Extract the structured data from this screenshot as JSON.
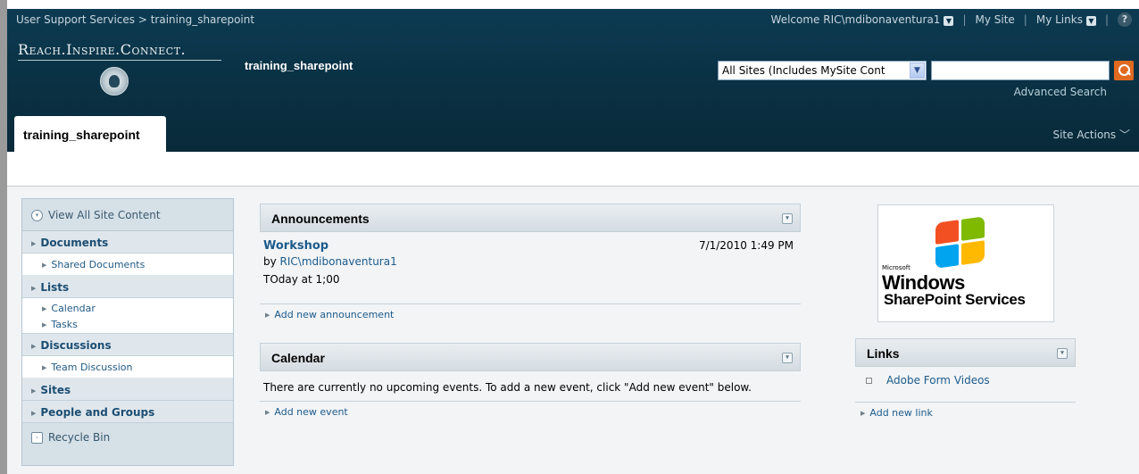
{
  "topbar": {
    "breadcrumb": "User Support Services > training_sharepoint",
    "welcome": "Welcome RIC\\mdibonaventura1",
    "my_site": "My Site",
    "my_links": "My Links",
    "help_glyph": "?"
  },
  "brand": {
    "logo_text": "Reach.Inspire.Connect.",
    "site_title": "training_sharepoint"
  },
  "search": {
    "scope_selected": "All Sites (Includes MySite Cont",
    "query_value": "",
    "advanced_label": "Advanced Search"
  },
  "tabs": [
    {
      "label": "training_sharepoint",
      "active": true
    }
  ],
  "site_actions_label": "Site Actions",
  "quick_launch": {
    "view_all": "View All Site Content",
    "sections": [
      {
        "label": "Documents",
        "items": [
          "Shared Documents"
        ]
      },
      {
        "label": "Lists",
        "items": [
          "Calendar",
          "Tasks"
        ]
      },
      {
        "label": "Discussions",
        "items": [
          "Team Discussion"
        ]
      },
      {
        "label": "Sites",
        "items": []
      },
      {
        "label": "People and Groups",
        "items": []
      }
    ],
    "recycle_bin": "Recycle Bin"
  },
  "announcements": {
    "title": "Announcements",
    "items": [
      {
        "title": "Workshop",
        "date": "7/1/2010 1:49 PM",
        "by_prefix": "by ",
        "author": "RIC\\mdibonaventura1",
        "body": "TOday at 1;00"
      }
    ],
    "add_label": "Add new announcement"
  },
  "calendar": {
    "title": "Calendar",
    "empty_message": "There are currently no upcoming events. To add a new event, click \"Add new event\" below.",
    "add_label": "Add new event"
  },
  "logo_image": {
    "microsoft": "Microsoft",
    "windows": "Windows",
    "product": "SharePoint Services"
  },
  "links": {
    "title": "Links",
    "items": [
      "Adobe Form Videos"
    ],
    "add_label": "Add new link"
  },
  "colors": {
    "header_dark": "#0a3245",
    "link_blue": "#1d5b8b",
    "search_go": "#e16a21",
    "quicklaunch_bg": "#d6e0e7"
  }
}
